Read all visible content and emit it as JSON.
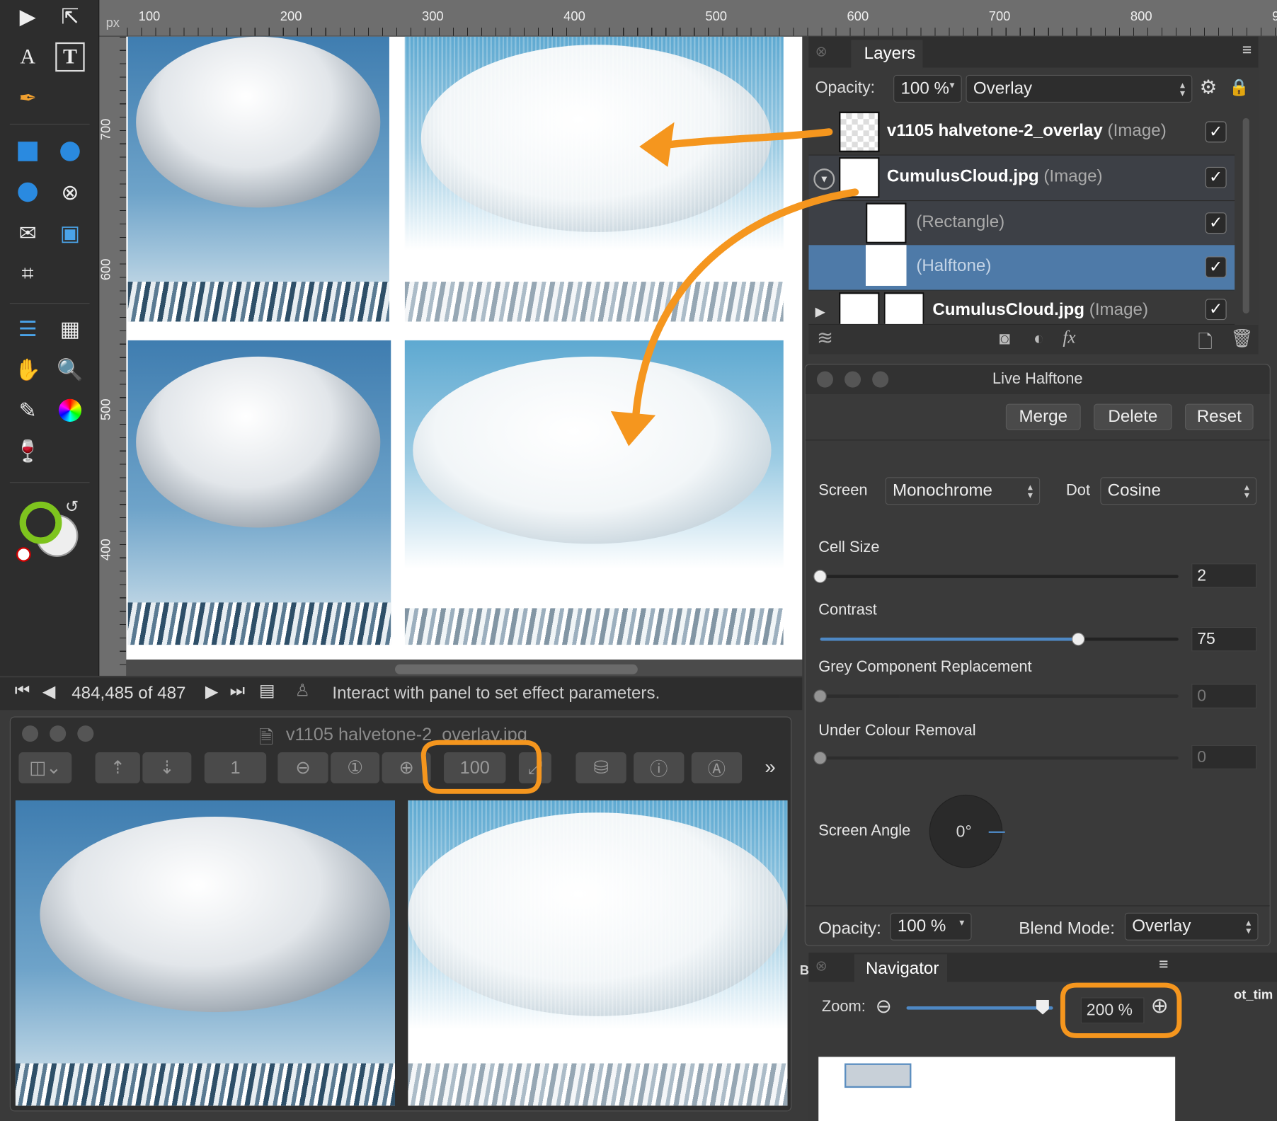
{
  "ruler": {
    "unit": "px",
    "top_ticks": [
      "100",
      "200",
      "300",
      "400",
      "500",
      "600",
      "700",
      "800",
      "9"
    ],
    "left_ticks": [
      "700",
      "600",
      "500",
      "400"
    ]
  },
  "status": {
    "page_position": "484,485 of 487",
    "message": "Interact with panel to set effect parameters."
  },
  "preview_window": {
    "title": "v1105 halvetone-2_overlay.jpg",
    "page_field": "1",
    "zoom_field": "100",
    "more": "»"
  },
  "layers": {
    "title": "Layers",
    "opacity_label": "Opacity:",
    "opacity_value": "100 %",
    "blend_mode": "Overlay",
    "items": [
      {
        "name": "v1105 halvetone-2_overlay",
        "type": "(Image)",
        "visible": true
      },
      {
        "name": "CumulusCloud.jpg",
        "type": "(Image)",
        "visible": true
      },
      {
        "name": "",
        "type": "(Rectangle)",
        "visible": true
      },
      {
        "name": "",
        "type": "(Halftone)",
        "visible": true,
        "selected": true
      },
      {
        "name": "CumulusCloud.jpg",
        "type": "(Image)",
        "visible": true
      }
    ],
    "check_glyph": "✓"
  },
  "live_halftone": {
    "title": "Live Halftone",
    "buttons": {
      "merge": "Merge",
      "delete": "Delete",
      "reset": "Reset"
    },
    "screen_label": "Screen",
    "screen_value": "Monochrome",
    "dot_label": "Dot",
    "dot_value": "Cosine",
    "cell_size_label": "Cell Size",
    "cell_size_value": "2",
    "contrast_label": "Contrast",
    "contrast_value": "75",
    "gcr_label": "Grey Component Replacement",
    "gcr_value": "0",
    "ucr_label": "Under Colour Removal",
    "ucr_value": "0",
    "screen_angle_label": "Screen Angle",
    "screen_angle_value": "0°",
    "opacity_label": "Opacity:",
    "opacity_value": "100 %",
    "blend_label": "Blend Mode:",
    "blend_value": "Overlay",
    "sliders": {
      "cell_size": 0.0,
      "contrast": 0.72,
      "gcr": 0.0,
      "ucr": 0.0
    }
  },
  "navigator": {
    "title": "Navigator",
    "zoom_label": "Zoom:",
    "zoom_value": "200 %",
    "zoom_slider": 0.93
  },
  "edge_text": {
    "left": "B",
    "right": "ot_tim"
  },
  "colors": {
    "accent": "#4e7aa8",
    "annotation": "#f5961e"
  }
}
